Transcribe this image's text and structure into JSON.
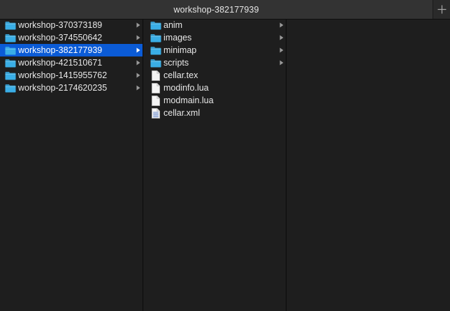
{
  "window": {
    "tab_title": "workshop-382177939",
    "new_tab_label": "+"
  },
  "colors": {
    "background": "#1e1e1e",
    "tabbar": "#2a2a2a",
    "selection": "#0b5bd6",
    "folder_icon": "#3aaee6",
    "text": "#e8e8e8"
  },
  "columns": [
    {
      "items": [
        {
          "name": "workshop-370373189",
          "kind": "folder",
          "icon": "folder-icon",
          "selected": false,
          "has_children": true
        },
        {
          "name": "workshop-374550642",
          "kind": "folder",
          "icon": "folder-icon",
          "selected": false,
          "has_children": true
        },
        {
          "name": "workshop-382177939",
          "kind": "folder",
          "icon": "folder-icon",
          "selected": true,
          "has_children": true
        },
        {
          "name": "workshop-421510671",
          "kind": "folder",
          "icon": "folder-icon",
          "selected": false,
          "has_children": true
        },
        {
          "name": "workshop-1415955762",
          "kind": "folder",
          "icon": "folder-icon",
          "selected": false,
          "has_children": true
        },
        {
          "name": "workshop-2174620235",
          "kind": "folder",
          "icon": "folder-icon",
          "selected": false,
          "has_children": true
        }
      ]
    },
    {
      "items": [
        {
          "name": "anim",
          "kind": "folder",
          "icon": "folder-icon",
          "selected": false,
          "has_children": true
        },
        {
          "name": "images",
          "kind": "folder",
          "icon": "folder-icon",
          "selected": false,
          "has_children": true
        },
        {
          "name": "minimap",
          "kind": "folder",
          "icon": "folder-icon",
          "selected": false,
          "has_children": true
        },
        {
          "name": "scripts",
          "kind": "folder",
          "icon": "folder-icon",
          "selected": false,
          "has_children": true
        },
        {
          "name": "cellar.tex",
          "kind": "file",
          "icon": "document-icon",
          "selected": false,
          "has_children": false
        },
        {
          "name": "modinfo.lua",
          "kind": "file",
          "icon": "document-icon",
          "selected": false,
          "has_children": false
        },
        {
          "name": "modmain.lua",
          "kind": "file",
          "icon": "document-icon",
          "selected": false,
          "has_children": false
        },
        {
          "name": "cellar.xml",
          "kind": "file",
          "icon": "text-document-icon",
          "selected": false,
          "has_children": false
        }
      ]
    },
    {
      "items": []
    }
  ]
}
